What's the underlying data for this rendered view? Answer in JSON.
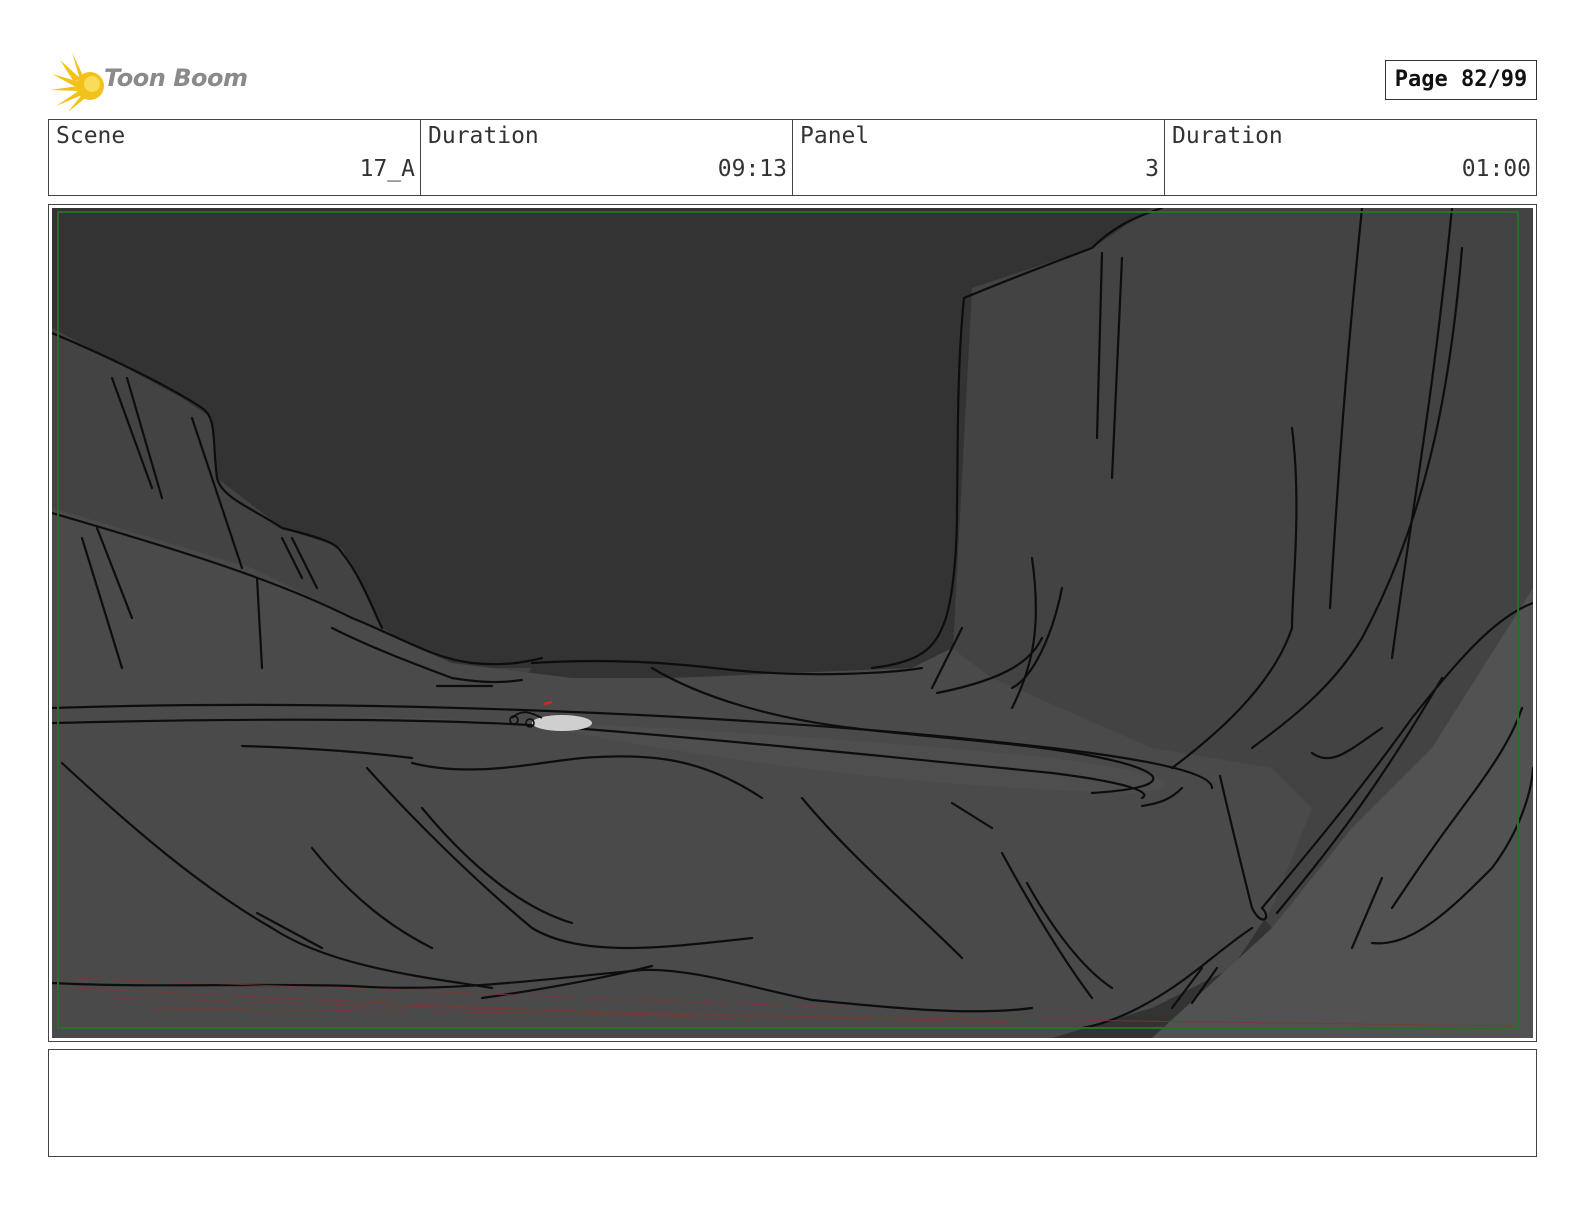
{
  "header": {
    "logo_text": "Toon Boom",
    "page_label": "Page 82/99"
  },
  "info": {
    "scene_label": "Scene",
    "scene_value": "17_A",
    "scene_duration_label": "Duration",
    "scene_duration_value": "09:13",
    "panel_label": "Panel",
    "panel_value": "3",
    "panel_duration_label": "Duration",
    "panel_duration_value": "01:00"
  },
  "colors": {
    "sky": "#333333",
    "cliff": "#434343",
    "ground": "#4a4a4a",
    "safe_frame": "#2d6b2d",
    "logo_yellow": "#f2c21b",
    "accent_red": "#cc2a1a"
  },
  "notes": {
    "text": ""
  }
}
